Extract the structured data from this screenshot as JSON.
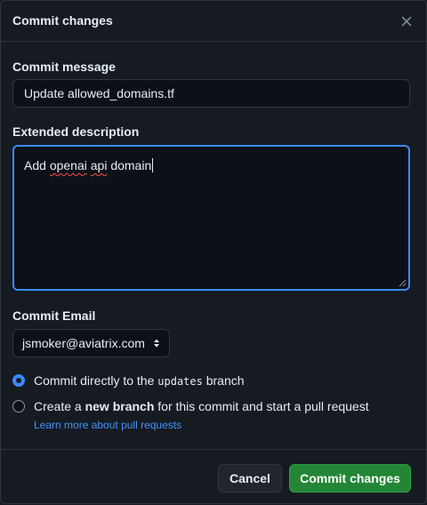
{
  "dialog": {
    "title": "Commit changes",
    "close_icon": "x-icon"
  },
  "commit_message": {
    "label": "Commit message",
    "value": "Update allowed_domains.tf"
  },
  "extended_description": {
    "label": "Extended description",
    "value_word1": "Add ",
    "value_word2": "openai",
    "value_word3": " ",
    "value_word4": "api",
    "value_word5": " domain"
  },
  "commit_email": {
    "label": "Commit Email",
    "selected": "jsmoker@aviatrix.com"
  },
  "branch_options": {
    "direct": {
      "prefix": "Commit directly to the ",
      "branch": "updates",
      "suffix": " branch",
      "checked": true
    },
    "new_branch": {
      "prefix": "Create a ",
      "bold": "new branch",
      "suffix": " for this commit and start a pull request",
      "checked": false
    },
    "learn_more": "Learn more about pull requests"
  },
  "footer": {
    "cancel_label": "Cancel",
    "commit_label": "Commit changes"
  },
  "colors": {
    "background": "#161b22",
    "input_bg": "#0d1117",
    "accent": "#388bfd",
    "primary_button": "#238636",
    "link": "#4493f8"
  }
}
